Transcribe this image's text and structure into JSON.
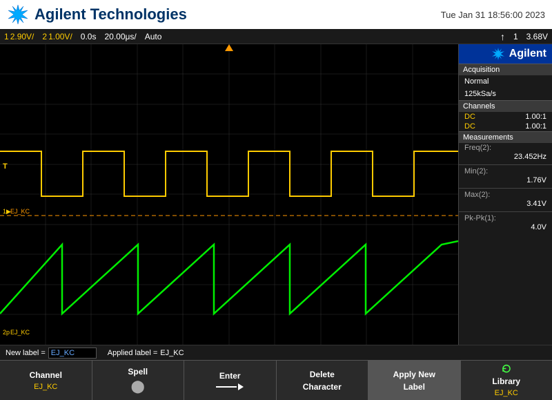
{
  "header": {
    "title": "Agilent Technologies",
    "datetime": "Tue Jan 31 18:56:00 2023"
  },
  "toolbar": {
    "ch1_label": "1",
    "ch1_value": "2.90V/",
    "ch2_label": "2",
    "ch2_value": "1.00V/",
    "time_value": "0.0s",
    "timebase": "20.00μs/",
    "mode": "Auto",
    "arrow": "↑",
    "ch_num": "1",
    "ch_voltage": "3.68V"
  },
  "right_panel": {
    "brand": "Agilent",
    "acquisition_title": "Acquisition",
    "acq_mode": "Normal",
    "acq_rate": "125kSa/s",
    "channels_title": "Channels",
    "ch1_dc": "DC",
    "ch1_ratio": "1.00:1",
    "ch2_dc": "DC",
    "ch2_ratio": "1.00:1",
    "measurements_title": "Measurements",
    "meas1_label": "Freq(2):",
    "meas1_value": "23.452Hz",
    "meas2_label": "Min(2):",
    "meas2_value": "1.76V",
    "meas3_label": "Max(2):",
    "meas3_value": "3.41V",
    "meas4_label": "Pk-Pk(1):",
    "meas4_value": "4.0V"
  },
  "label_row": {
    "new_label_prefix": "New label =",
    "new_label_value": "EJ_KC",
    "applied_label_prefix": "Applied label =",
    "applied_label_value": "EJ_KC"
  },
  "bottom_bar": {
    "btn1_label": "Channel",
    "btn1_sub": "EJ_KC",
    "btn2_label": "Spell",
    "btn2_sub": "",
    "btn3_label": "Enter",
    "btn3_sub": "",
    "btn4_label": "Delete\nCharacter",
    "btn5_label": "Apply New\nLabel",
    "btn6_label": "Library",
    "btn6_sub": "EJ_KC"
  },
  "scope": {
    "ch1_marker": "T",
    "ch1_label": "1▶",
    "ch2_label": "1p",
    "ch2_signal_label": "EJ_KC",
    "scope_label_bottom": "2p",
    "scope_label_bottom2": "EJ_KC"
  }
}
